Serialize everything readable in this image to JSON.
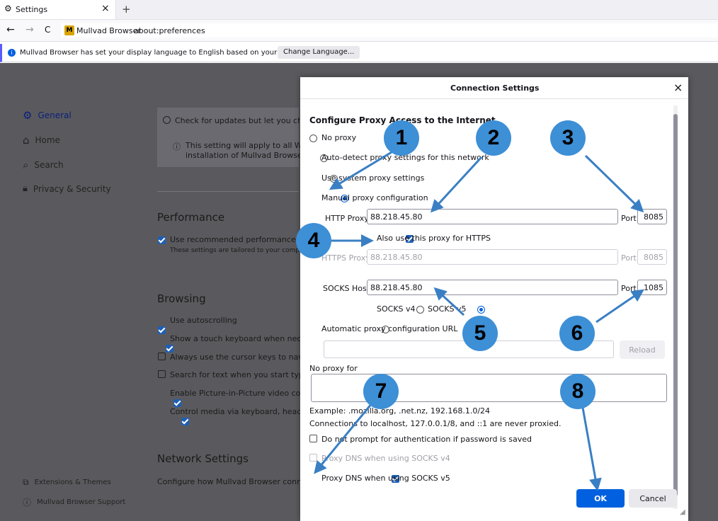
{
  "tab": {
    "title": "Settings",
    "close": "×",
    "new_tab": "+"
  },
  "nav": {
    "back": "←",
    "forward": "→",
    "reload": "C",
    "identity": "Mullvad Browser",
    "url": "about:preferences"
  },
  "notice": {
    "text": "Mullvad Browser has set your display language to English based on your system's language.",
    "button": "Change Language..."
  },
  "sidebar": {
    "items": [
      {
        "label": "General"
      },
      {
        "label": "Home"
      },
      {
        "label": "Search"
      },
      {
        "label": "Privacy & Security"
      }
    ],
    "footer": [
      {
        "label": "Extensions & Themes"
      },
      {
        "label": "Mullvad Browser Support"
      }
    ]
  },
  "main": {
    "update_option": "Check for updates but let you choos",
    "update_note_1": "This setting will apply to all Windo",
    "update_note_2": "installation of Mullvad Browser.",
    "performance_heading": "Performance",
    "performance_option": "Use recommended performance setti",
    "performance_note": "These settings are tailored to your compu",
    "browsing_heading": "Browsing",
    "browsing_options": [
      {
        "label": "Use autoscrolling",
        "checked": true
      },
      {
        "label": "Show a touch keyboard when necessa",
        "checked": true
      },
      {
        "label": "Always use the cursor keys to navigate",
        "checked": false
      },
      {
        "label": "Search for text when you start typing",
        "checked": false
      },
      {
        "label": "Enable Picture-in-Picture video contro",
        "checked": true
      },
      {
        "label": "Control media via keyboard, headset, c",
        "checked": true
      }
    ],
    "network_heading": "Network Settings",
    "network_text": "Configure how Mullvad Browser connects"
  },
  "dialog": {
    "title": "Connection Settings",
    "close": "×",
    "heading": "Configure Proxy Access to the Internet",
    "proxy_options": [
      "No proxy",
      "Auto-detect proxy settings for this network",
      "Use system proxy settings",
      "Manual proxy configuration"
    ],
    "http_proxy_label": "HTTP Proxy",
    "http_proxy_value": "88.218.45.80",
    "port_label": "Port",
    "http_port": "8085",
    "also_https": "Also use this proxy for HTTPS",
    "https_proxy_label": "HTTPS Proxy",
    "https_proxy_value": "88.218.45.80",
    "https_port": "8085",
    "socks_label": "SOCKS Host",
    "socks_value": "88.218.45.80",
    "socks_port": "1085",
    "socks_v4": "SOCKS v4",
    "socks_v5": "SOCKS v5",
    "auto_url_label": "Automatic proxy configuration URL",
    "reload": "Reload",
    "no_proxy_label": "No proxy for",
    "example": "Example: .mozilla.org, .net.nz, 192.168.1.0/24",
    "localhost_note": "Connections to localhost, 127.0.0.1/8, and ::1 are never proxied.",
    "no_auth_prompt": "Do not prompt for authentication if password is saved",
    "dns_v4": "Proxy DNS when using SOCKS v4",
    "dns_v5": "Proxy DNS when using SOCKS v5",
    "ok": "OK",
    "cancel": "Cancel"
  },
  "markers": [
    "1",
    "2",
    "3",
    "4",
    "5",
    "6",
    "7",
    "8"
  ],
  "colors": {
    "accent": "#0060df",
    "marker": "#3d8fd6",
    "arrow": "#3a7fc4",
    "overlay": "#5a5a5e"
  }
}
